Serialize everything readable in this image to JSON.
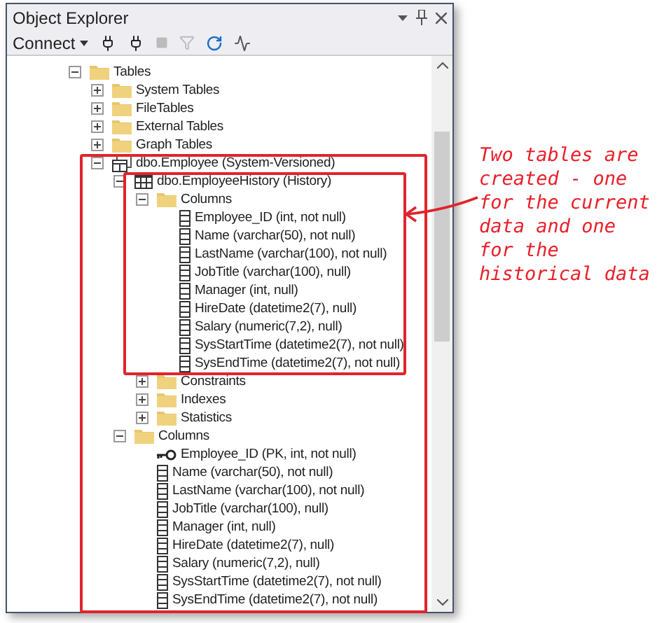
{
  "window": {
    "title": "Object Explorer"
  },
  "toolbar": {
    "connect": "Connect"
  },
  "tree": [
    {
      "label": "Tables",
      "kind": "folder",
      "expanded": true,
      "children": [
        {
          "label": "System Tables",
          "kind": "folder",
          "expanded": false
        },
        {
          "label": "FileTables",
          "kind": "folder",
          "expanded": false
        },
        {
          "label": "External Tables",
          "kind": "folder",
          "expanded": false
        },
        {
          "label": "Graph Tables",
          "kind": "folder",
          "expanded": false
        },
        {
          "label": "dbo.Employee (System-Versioned)",
          "kind": "versioned",
          "expanded": true,
          "children": [
            {
              "label": "dbo.EmployeeHistory (History)",
              "kind": "table",
              "expanded": true,
              "children": [
                {
                  "label": "Columns",
                  "kind": "folder",
                  "expanded": true,
                  "children": [
                    {
                      "label": "Employee_ID (int, not null)",
                      "kind": "column"
                    },
                    {
                      "label": "Name (varchar(50), not null)",
                      "kind": "column"
                    },
                    {
                      "label": "LastName (varchar(100), not null)",
                      "kind": "column"
                    },
                    {
                      "label": "JobTitle (varchar(100), null)",
                      "kind": "column"
                    },
                    {
                      "label": "Manager (int, null)",
                      "kind": "column"
                    },
                    {
                      "label": "HireDate (datetime2(7), null)",
                      "kind": "column"
                    },
                    {
                      "label": "Salary (numeric(7,2), null)",
                      "kind": "column"
                    },
                    {
                      "label": "SysStartTime (datetime2(7), not null)",
                      "kind": "column"
                    },
                    {
                      "label": "SysEndTime (datetime2(7), not null)",
                      "kind": "column"
                    }
                  ]
                },
                {
                  "label": "Constraints",
                  "kind": "folder",
                  "expanded": false
                },
                {
                  "label": "Indexes",
                  "kind": "folder",
                  "expanded": false
                },
                {
                  "label": "Statistics",
                  "kind": "folder",
                  "expanded": false
                }
              ]
            },
            {
              "label": "Columns",
              "kind": "folder",
              "expanded": true,
              "children": [
                {
                  "label": "Employee_ID (PK, int, not null)",
                  "kind": "key"
                },
                {
                  "label": "Name (varchar(50), not null)",
                  "kind": "column"
                },
                {
                  "label": "LastName (varchar(100), not null)",
                  "kind": "column"
                },
                {
                  "label": "JobTitle (varchar(100), null)",
                  "kind": "column"
                },
                {
                  "label": "Manager (int, null)",
                  "kind": "column"
                },
                {
                  "label": "HireDate (datetime2(7), null)",
                  "kind": "column"
                },
                {
                  "label": "Salary (numeric(7,2), null)",
                  "kind": "column"
                },
                {
                  "label": "SysStartTime (datetime2(7), not null)",
                  "kind": "column"
                },
                {
                  "label": "SysEndTime (datetime2(7), not null)",
                  "kind": "column"
                }
              ]
            }
          ]
        }
      ]
    }
  ],
  "annotation": {
    "lines": [
      "Two tables are",
      "created - one",
      "for the current",
      "data and one",
      "for the",
      "historical data"
    ]
  }
}
